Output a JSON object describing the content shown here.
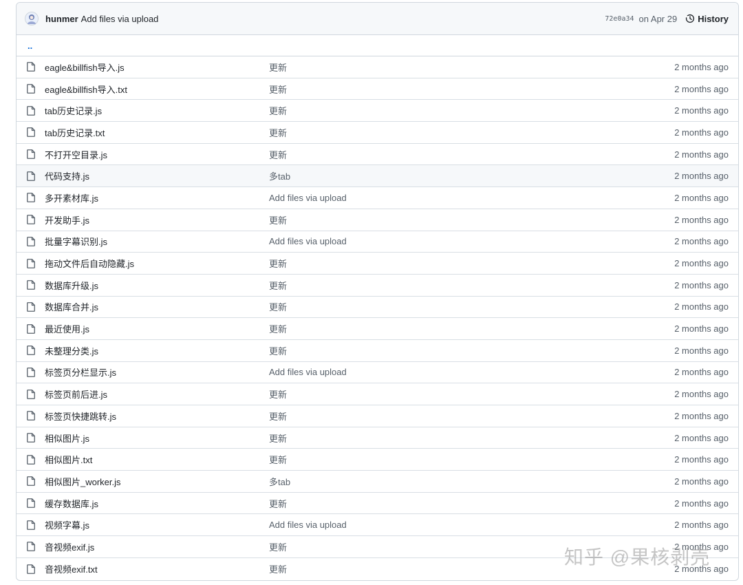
{
  "commit": {
    "author": "hunmer",
    "message": "Add files via upload",
    "sha": "72e0a34",
    "date": "on Apr 29",
    "history_label": "History"
  },
  "parent_link": "..",
  "files": [
    {
      "name": "eagle&billfish导入.js",
      "message": "更新",
      "age": "2 months ago"
    },
    {
      "name": "eagle&billfish导入.txt",
      "message": "更新",
      "age": "2 months ago"
    },
    {
      "name": "tab历史记录.js",
      "message": "更新",
      "age": "2 months ago"
    },
    {
      "name": "tab历史记录.txt",
      "message": "更新",
      "age": "2 months ago"
    },
    {
      "name": "不打开空目录.js",
      "message": "更新",
      "age": "2 months ago"
    },
    {
      "name": "代码支持.js",
      "message": "多tab",
      "age": "2 months ago"
    },
    {
      "name": "多开素材库.js",
      "message": "Add files via upload",
      "age": "2 months ago"
    },
    {
      "name": "开发助手.js",
      "message": "更新",
      "age": "2 months ago"
    },
    {
      "name": "批量字幕识别.js",
      "message": "Add files via upload",
      "age": "2 months ago"
    },
    {
      "name": "拖动文件后自动隐藏.js",
      "message": "更新",
      "age": "2 months ago"
    },
    {
      "name": "数据库升级.js",
      "message": "更新",
      "age": "2 months ago"
    },
    {
      "name": "数据库合并.js",
      "message": "更新",
      "age": "2 months ago"
    },
    {
      "name": "最近使用.js",
      "message": "更新",
      "age": "2 months ago"
    },
    {
      "name": "未整理分类.js",
      "message": "更新",
      "age": "2 months ago"
    },
    {
      "name": "标签页分栏显示.js",
      "message": "Add files via upload",
      "age": "2 months ago"
    },
    {
      "name": "标签页前后进.js",
      "message": "更新",
      "age": "2 months ago"
    },
    {
      "name": "标签页快捷跳转.js",
      "message": "更新",
      "age": "2 months ago"
    },
    {
      "name": "相似图片.js",
      "message": "更新",
      "age": "2 months ago"
    },
    {
      "name": "相似图片.txt",
      "message": "更新",
      "age": "2 months ago"
    },
    {
      "name": "相似图片_worker.js",
      "message": "多tab",
      "age": "2 months ago"
    },
    {
      "name": "缓存数据库.js",
      "message": "更新",
      "age": "2 months ago"
    },
    {
      "name": "视频字幕.js",
      "message": "Add files via upload",
      "age": "2 months ago"
    },
    {
      "name": "音视频exif.js",
      "message": "更新",
      "age": "2 months ago"
    },
    {
      "name": "音视频exif.txt",
      "message": "更新",
      "age": "2 months ago"
    }
  ],
  "hovered_row_index": 5,
  "watermark": "知乎 @果核剥壳",
  "icons": {
    "avatar": "avatar",
    "history": "history-icon",
    "file": "file-icon"
  }
}
